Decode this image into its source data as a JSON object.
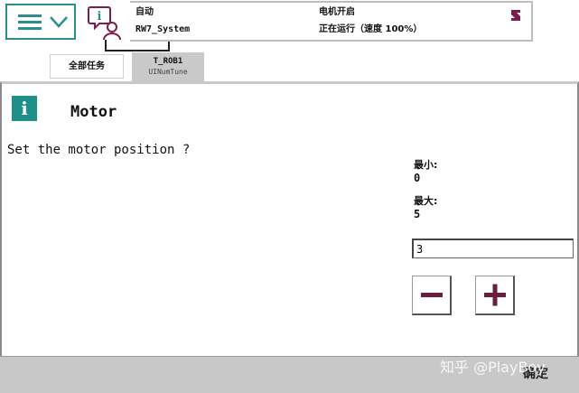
{
  "status": {
    "mode": "自动",
    "system": "RW7_System",
    "motor_state": "电机开启",
    "run_state": "正在运行（速度 100%）"
  },
  "tabs": [
    {
      "label": "全部任务"
    },
    {
      "title": "T_ROB1",
      "subtitle": "UINumTune"
    }
  ],
  "dialog": {
    "title": "Motor",
    "prompt": "Set the motor position ?",
    "min_label": "最小:",
    "min_value": "0",
    "max_label": "最大:",
    "max_value": "5",
    "input_value": "3"
  },
  "footer": {
    "ok_label": "确定",
    "watermark": "知乎 @PlayBoy"
  },
  "colors": {
    "accent": "#2e8f8a",
    "stepper_glyph": "#6b1f3f",
    "bottom_bar": "#c8c8c8"
  },
  "icons": [
    "menu-icon",
    "chevron-down-icon",
    "info-user-icon",
    "abb-logo-icon",
    "info-icon",
    "minus-icon",
    "plus-icon"
  ]
}
